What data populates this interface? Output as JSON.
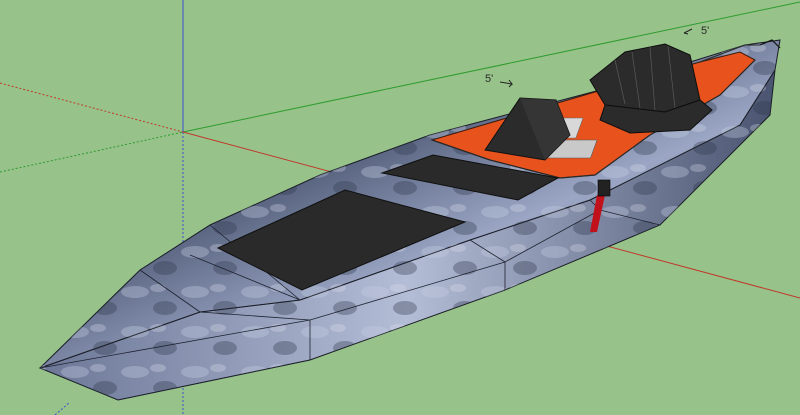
{
  "viewport": {
    "background_color": "#97c28a",
    "axis_colors": {
      "red": "#c0392b",
      "green": "#2e9b2e",
      "blue": "#3a4fd0"
    }
  },
  "dimensions": [
    {
      "label": "5'"
    },
    {
      "label": "5'"
    }
  ],
  "model": {
    "hull_color": "#5d6a86",
    "deck_color": "#e8531d",
    "seat_color": "#2b2b2b",
    "hatch_color": "#2a2a2a",
    "accent_color": "#c1121c"
  }
}
